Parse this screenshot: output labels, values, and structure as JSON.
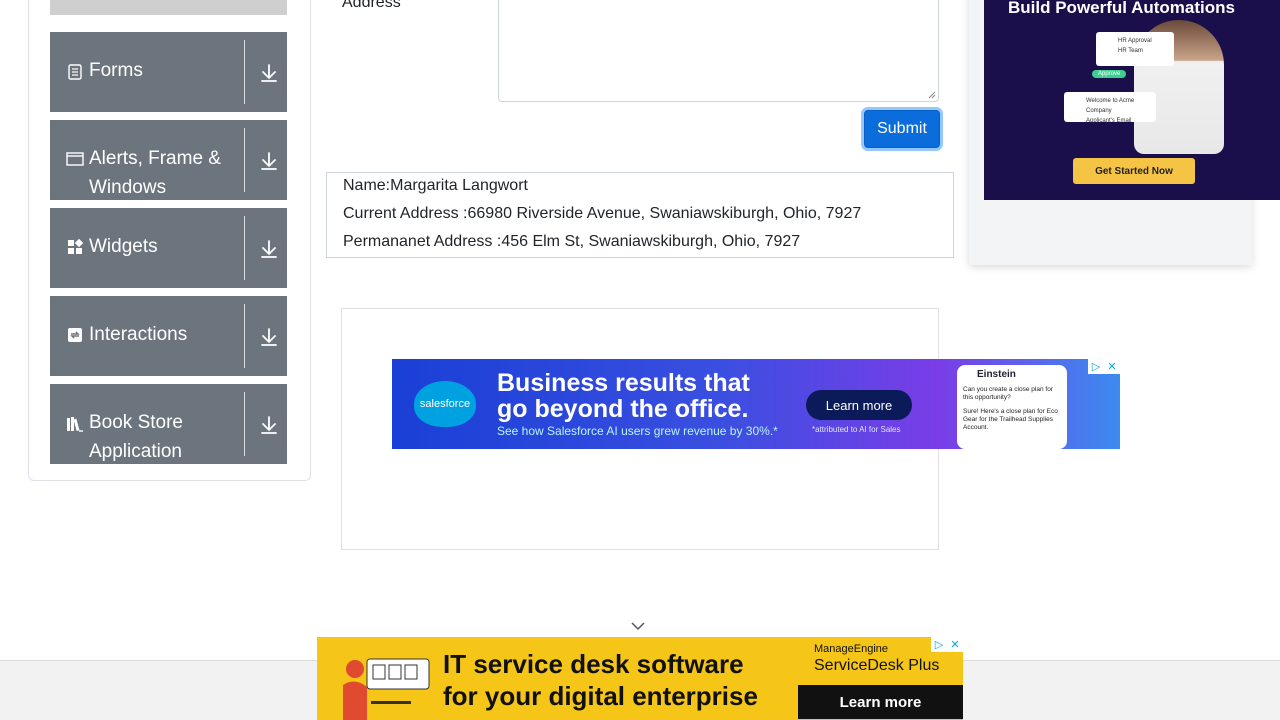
{
  "sidebar": {
    "groups": [
      {
        "label": "Forms",
        "icon": "form-icon"
      },
      {
        "label": "Alerts, Frame & Windows",
        "icon": "window-icon"
      },
      {
        "label": "Widgets",
        "icon": "widgets-icon"
      },
      {
        "label": "Interactions",
        "icon": "interactions-icon"
      },
      {
        "label": "Book Store Application",
        "icon": "book-icon"
      }
    ]
  },
  "form": {
    "address_label": "Address",
    "submit_label": "Submit"
  },
  "output": {
    "name": "Name:Margarita Langwort",
    "current_address": "Current Address :66980 Riverside Avenue, Swaniawskiburgh, Ohio, 7927",
    "permanent_address": "Permananet Address :456 Elm St, Swaniawskiburgh, Ohio, 7927"
  },
  "ads": {
    "salesforce": {
      "logo": "salesforce",
      "headline_1": "Business results that",
      "headline_2": "go beyond the office.",
      "sub": "See how Salesforce AI users grew revenue by 30%.*",
      "cta": "Learn more",
      "note": "*attributed to AI for Sales",
      "widget_title": "Einstein",
      "widget_q": "Can you create a close plan for this opportunity?",
      "widget_a": "Sure! Here's a close plan for Eco Gear for the Trailhead Supplies Account."
    },
    "automation": {
      "title": "Build Powerful Automations",
      "card1_l1": "HR Approval",
      "card1_l2": "HR Team",
      "approve": "Approve",
      "card2_l1": "Welcome to Acme Company",
      "card2_l2": "Applicant's Email",
      "cta": "Get Started Now"
    },
    "manageengine": {
      "line1": "IT service desk software",
      "line2": "for your digital enterprise",
      "brand1": "ManageEngine",
      "brand2": "ServiceDesk Plus",
      "cta": "Learn more"
    }
  }
}
